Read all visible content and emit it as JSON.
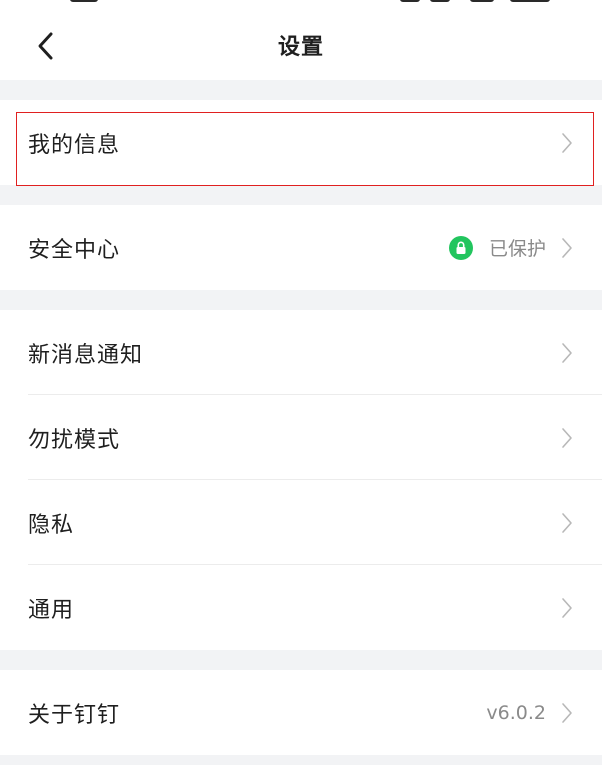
{
  "nav": {
    "title": "设置"
  },
  "groups": [
    {
      "items": [
        {
          "label": "我的信息",
          "value": ""
        }
      ]
    },
    {
      "items": [
        {
          "label": "安全中心",
          "value": "已保护",
          "badge": "lock-icon"
        }
      ]
    },
    {
      "items": [
        {
          "label": "新消息通知",
          "value": ""
        },
        {
          "label": "勿扰模式",
          "value": ""
        },
        {
          "label": "隐私",
          "value": ""
        },
        {
          "label": "通用",
          "value": ""
        }
      ]
    },
    {
      "items": [
        {
          "label": "关于钉钉",
          "value": "v6.0.2"
        }
      ]
    }
  ],
  "colors": {
    "background": "#f2f3f5",
    "card": "#ffffff",
    "text": "#1f1f1f",
    "secondary_text": "#8a8a8a",
    "chevron": "#b8b8b8",
    "security_green": "#22c55e",
    "highlight": "#e02020"
  },
  "icons": {
    "back": "chevron-left-icon",
    "row_arrow": "chevron-right-icon",
    "security_badge": "lock-icon"
  }
}
